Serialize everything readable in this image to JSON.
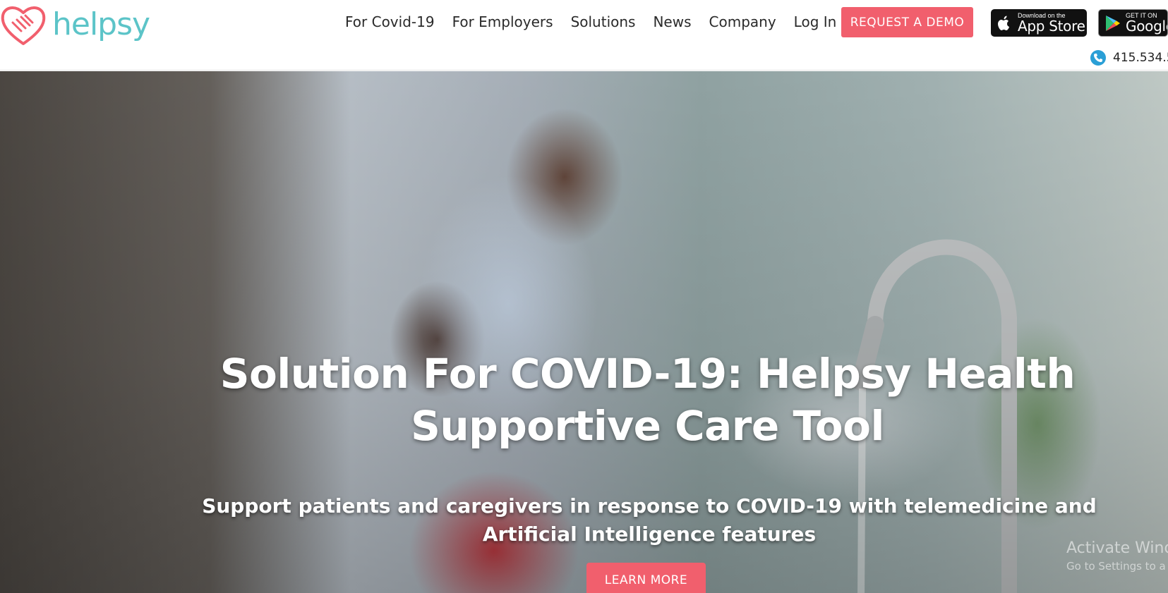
{
  "brand": {
    "name": "helpsy",
    "logo_icon": "heart-hands-icon",
    "logo_color": "#5cc4c8",
    "heart_color": "#f15f6d"
  },
  "nav": {
    "items": [
      {
        "label": "For Covid-19"
      },
      {
        "label": "For Employers"
      },
      {
        "label": "Solutions"
      },
      {
        "label": "News"
      },
      {
        "label": "Company"
      },
      {
        "label": "Log In"
      }
    ],
    "demo_label": "REQUEST A DEMO",
    "accent_color": "#f15f6d"
  },
  "stores": {
    "appstore": {
      "small": "Download on the",
      "big": "App Store",
      "icon": "apple-icon"
    },
    "gplay": {
      "small": "GET IT ON",
      "big": "Google",
      "icon": "google-play-icon"
    }
  },
  "contact": {
    "phone": "415.534.5",
    "icon": "phone-icon",
    "icon_color": "#2a9fd6"
  },
  "hero": {
    "title": "Solution For COVID-19: Helpsy Health Supportive Care Tool",
    "subtitle": "Support patients and caregivers in response to COVID-19 with telemedicine and Artificial Intelligence features",
    "cta_label": "LEARN MORE"
  },
  "watermark": {
    "title": "Activate Wind",
    "subtitle": "Go to Settings to a"
  }
}
